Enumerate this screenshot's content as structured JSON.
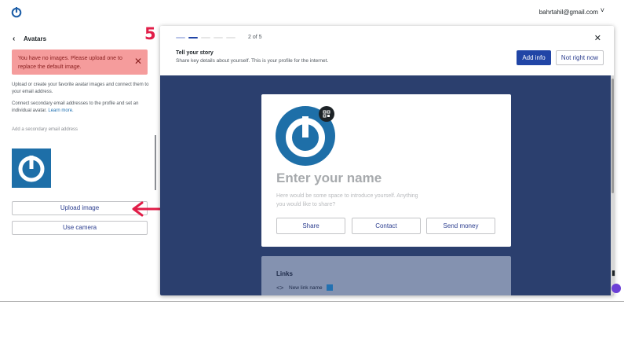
{
  "header": {
    "logo_icon": "gravatar-power-icon",
    "account_email": "bahrtahil@gmail.com",
    "account_chevron": "˅"
  },
  "sidebar": {
    "back_glyph": "‹",
    "title": "Avatars",
    "notice": {
      "text": "You have no images. Please upload one to replace the default image.",
      "close": "✕",
      "color": "#f59c9c"
    },
    "paragraph1": "Upload or create your favorite avatar images and connect them to your email address.",
    "paragraph2": "Connect secondary email addresses to the profile and set an individual avatar.",
    "learn_more": "Learn more.",
    "secondary_email": "Add a secondary email address",
    "upload_button": "Upload image",
    "camera_button": "Use camera"
  },
  "annotation": {
    "step_number": "5",
    "color": "#e11d48"
  },
  "modal": {
    "step_label": "2 of 5",
    "progress_fraction": 0.4,
    "close": "✕",
    "title": "Tell your story",
    "subtitle": "Share key details about yourself. This is your profile for the internet.",
    "primary_button": "Add info",
    "secondary_button": "Not right now",
    "accent_color": "#2145a6"
  },
  "preview": {
    "name_placeholder": "Enter your name",
    "about_placeholder": "Here would be some space to introduce yourself. Anything you would like to share?",
    "buttons": [
      "Share",
      "Contact",
      "Send money"
    ],
    "qr_icon": "⌗",
    "links_title": "Links",
    "link_icon": "<>",
    "link_name": "New link name",
    "background_color": "#2b3f6e"
  },
  "edge_icons": {
    "book_icon": "▮",
    "assistant_icon": "assistant-icon"
  }
}
